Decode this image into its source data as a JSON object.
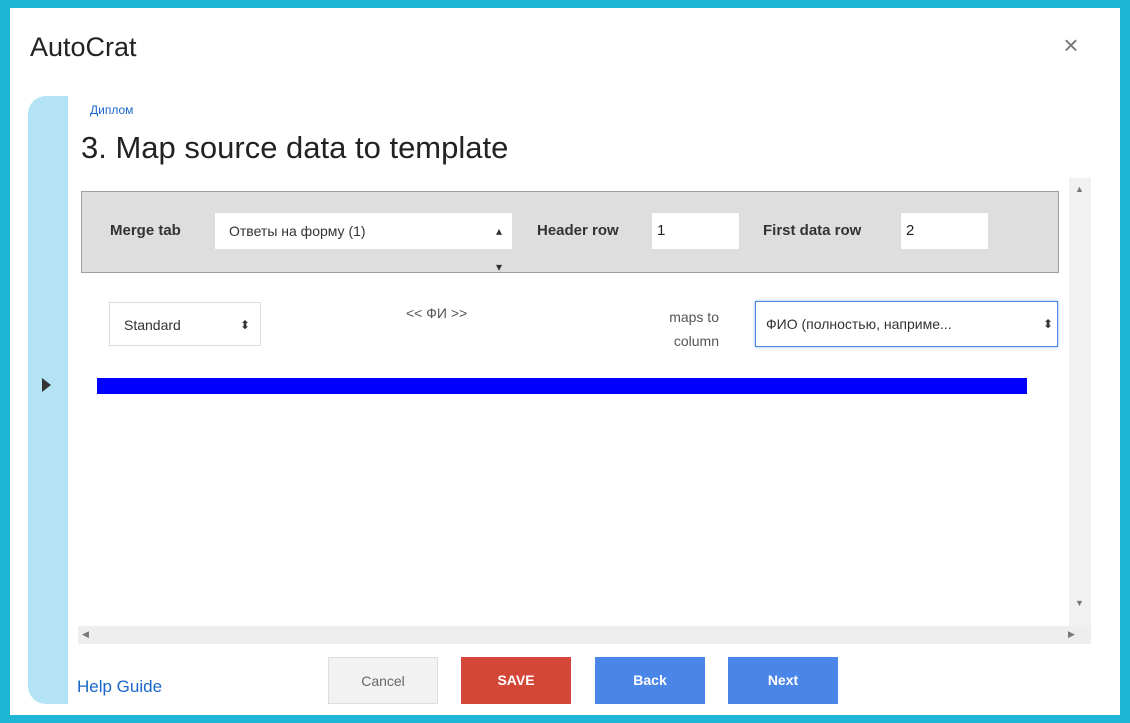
{
  "app": {
    "title": "AutoCrat",
    "close_symbol": "×"
  },
  "breadcrumb": "Диплом",
  "page_title": "3. Map source data to template",
  "merge_bar": {
    "merge_tab_label": "Merge tab",
    "merge_tab_value": "Ответы на форму (1)",
    "header_row_label": "Header row",
    "header_row_value": "1",
    "first_data_row_label": "First data row",
    "first_data_row_value": "2"
  },
  "mapping": {
    "type_value": "Standard",
    "tag": "<< ФИ >>",
    "maps_to_line1": "maps to",
    "maps_to_line2": "column",
    "column_value": "ФИО (полностью, наприме..."
  },
  "footer": {
    "help_guide": "Help Guide",
    "cancel": "Cancel",
    "save": "SAVE",
    "back": "Back",
    "next": "Next"
  },
  "icons": {
    "close": "close-icon",
    "expand": "chevron-right-icon",
    "select_arrows": "updown-arrows-icon"
  },
  "colors": {
    "frame": "#1fb6d6",
    "side_rail": "#b3e3f5",
    "save": "#d44638",
    "primary": "#4a86e8",
    "highlight_bar": "#0000ff"
  }
}
